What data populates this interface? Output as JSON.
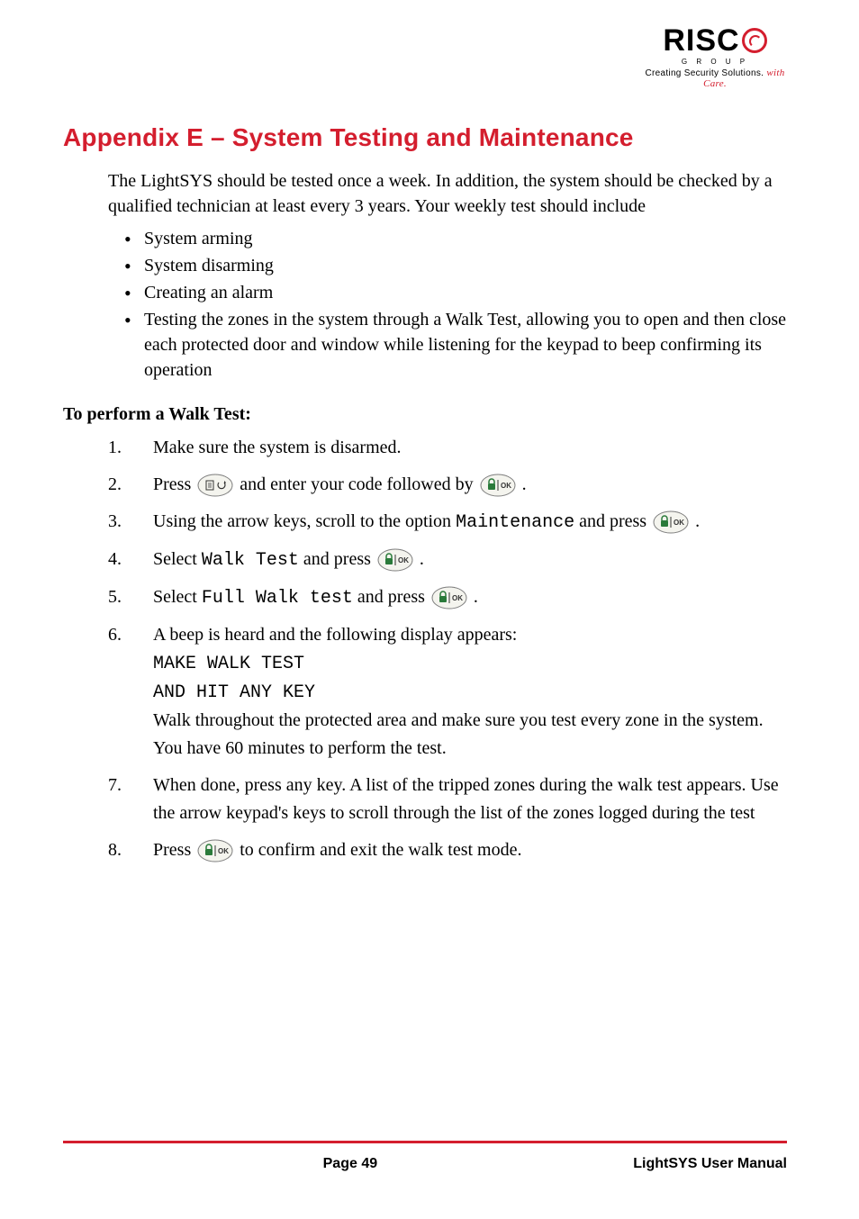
{
  "logo": {
    "brand_prefix": "RISC",
    "group": "G R O U P",
    "tagline_plain": "Creating Security Solutions.",
    "tagline_italic": "with Care."
  },
  "heading": "Appendix E – System Testing and Maintenance",
  "intro": "The LightSYS should be tested once a week. In addition, the system should be checked by a qualified technician at least every 3 years. Your weekly test should include",
  "bullets": [
    "System arming",
    "System disarming",
    "Creating an alarm",
    "Testing the zones in the system through a Walk Test, allowing you to open and then close each protected door and window while listening for the keypad to beep confirming its operation"
  ],
  "walk_test_heading": "To perform a Walk Test:",
  "steps": {
    "s1": "Make sure the system is disarmed.",
    "s2a": "Press ",
    "s2b": " and enter your code followed by ",
    "s2c": ".",
    "s3a": "Using the arrow keys, scroll to the option ",
    "s3_code": "Maintenance",
    "s3b": " and press ",
    "s3c": ".",
    "s4a": "Select ",
    "s4_code": "Walk Test",
    "s4b": " and press ",
    "s4c": ".",
    "s5a": "Select ",
    "s5_code": "Full Walk test",
    "s5b": " and press ",
    "s5c": ".",
    "s6a": "A beep is heard and the following display appears:",
    "s6_display1": "MAKE WALK TEST",
    "s6_display2": "AND HIT ANY KEY",
    "s6b": "Walk throughout the protected area and make sure you test every zone in the system. You have 60 minutes to perform the test.",
    "s7": "When done, press any key. A list of the tripped zones during the walk test appears. Use the arrow keypad's keys to scroll through the list of the zones logged during the test",
    "s8a": "Press ",
    "s8b": " to confirm and exit the walk test mode."
  },
  "icons": {
    "menu_key": "menu-back-key-icon",
    "ok_key": "lock-ok-key-icon"
  },
  "footer": {
    "page": "Page 49",
    "manual": "LightSYS User Manual"
  }
}
